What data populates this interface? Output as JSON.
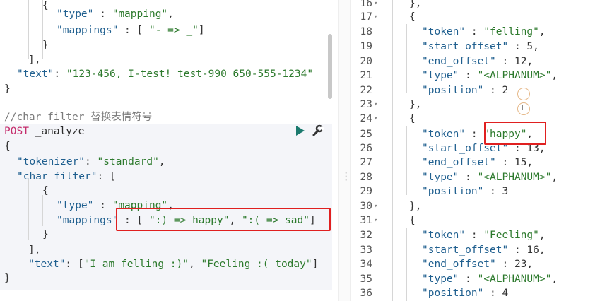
{
  "console": {
    "top_block": {
      "l1": "{",
      "l2_key": "\"type\"",
      "l2_sep": " : ",
      "l2_val": "\"mapping\"",
      "l2_end": ",",
      "l3_key": "\"mappings\"",
      "l3_sep": " : [ ",
      "l3_val": "\"- => _\"",
      "l3_end": "]",
      "l4": "}",
      "l5": "],",
      "l6_key": "\"text\"",
      "l6_sep": ": ",
      "l6_val": "\"123-456, I-test! test-990 650-555-1234\"",
      "l7": "}"
    },
    "comment": "//char filter 替换表情符号",
    "request": {
      "method": "POST",
      "endpoint": "_analyze",
      "l1": "{",
      "tokenizer_key": "\"tokenizer\"",
      "tokenizer_sep": ": ",
      "tokenizer_val": "\"standard\"",
      "tokenizer_end": ",",
      "charfilter_key": "\"char_filter\"",
      "charfilter_sep": ": [",
      "l4": "{",
      "type_key": "\"type\"",
      "type_sep": " : ",
      "type_val": "\"mapping\"",
      "type_end": ",",
      "mappings_key": "\"mappings\"",
      "mappings_sep": " : [ ",
      "mappings_val1": "\":) => happy\"",
      "mappings_comma": ", ",
      "mappings_val2": "\":( => sad\"",
      "mappings_end": "]",
      "l7": "}",
      "l8": "],",
      "text_key": "\"text\"",
      "text_sep": ": [",
      "text_val1": "\"I am felling :)\"",
      "text_comma": ", ",
      "text_val2": "\"Feeling :( today\"",
      "text_end": "]",
      "l10": "}"
    },
    "icons": [
      "play-icon",
      "wrench-icon"
    ]
  },
  "response": {
    "line_numbers": [
      "16",
      "17",
      "18",
      "19",
      "20",
      "21",
      "22",
      "23",
      "24",
      "25",
      "26",
      "27",
      "28",
      "29",
      "30",
      "31",
      "32",
      "33",
      "34",
      "35",
      "36"
    ],
    "lines": {
      "l16": "},",
      "l17": "{",
      "l18_key": "\"token\"",
      "l18_sep": " : ",
      "l18_val": "\"felling\"",
      "l18_end": ",",
      "l19_key": "\"start_offset\"",
      "l19_sep": " : ",
      "l19_val": "5",
      "l19_end": ",",
      "l20_key": "\"end_offset\"",
      "l20_sep": " : ",
      "l20_val": "12",
      "l20_end": ",",
      "l21_key": "\"type\"",
      "l21_sep": " : ",
      "l21_val": "\"<ALPHANUM>\"",
      "l21_end": ",",
      "l22_key": "\"position\"",
      "l22_sep": " : ",
      "l22_val": "2",
      "l23": "},",
      "l24": "{",
      "l25_key": "\"token\"",
      "l25_sep": " : ",
      "l25_val": "\"happy\"",
      "l25_end": ",",
      "l26_key": "\"start_offset\"",
      "l26_sep": " : ",
      "l26_val": "13",
      "l26_end": ",",
      "l27_key": "\"end_offset\"",
      "l27_sep": " : ",
      "l27_val": "15",
      "l27_end": ",",
      "l28_key": "\"type\"",
      "l28_sep": " : ",
      "l28_val": "\"<ALPHANUM>\"",
      "l28_end": ",",
      "l29_key": "\"position\"",
      "l29_sep": " : ",
      "l29_val": "3",
      "l30": "},",
      "l31": "{",
      "l32_key": "\"token\"",
      "l32_sep": " : ",
      "l32_val": "\"Feeling\"",
      "l32_end": ",",
      "l33_key": "\"start_offset\"",
      "l33_sep": " : ",
      "l33_val": "16",
      "l33_end": ",",
      "l34_key": "\"end_offset\"",
      "l34_sep": " : ",
      "l34_val": "23",
      "l34_end": ",",
      "l35_key": "\"type\"",
      "l35_sep": " : ",
      "l35_val": "\"<ALPHANUM>\"",
      "l35_end": ",",
      "l36_key": "\"position\"",
      "l36_sep": " : ",
      "l36_val": "4"
    }
  },
  "colors": {
    "key": "#1f5f8f",
    "string": "#2d7a2d",
    "method": "#c52d6c",
    "highlight": "#e02020",
    "request_background": "#f4f5f9"
  }
}
